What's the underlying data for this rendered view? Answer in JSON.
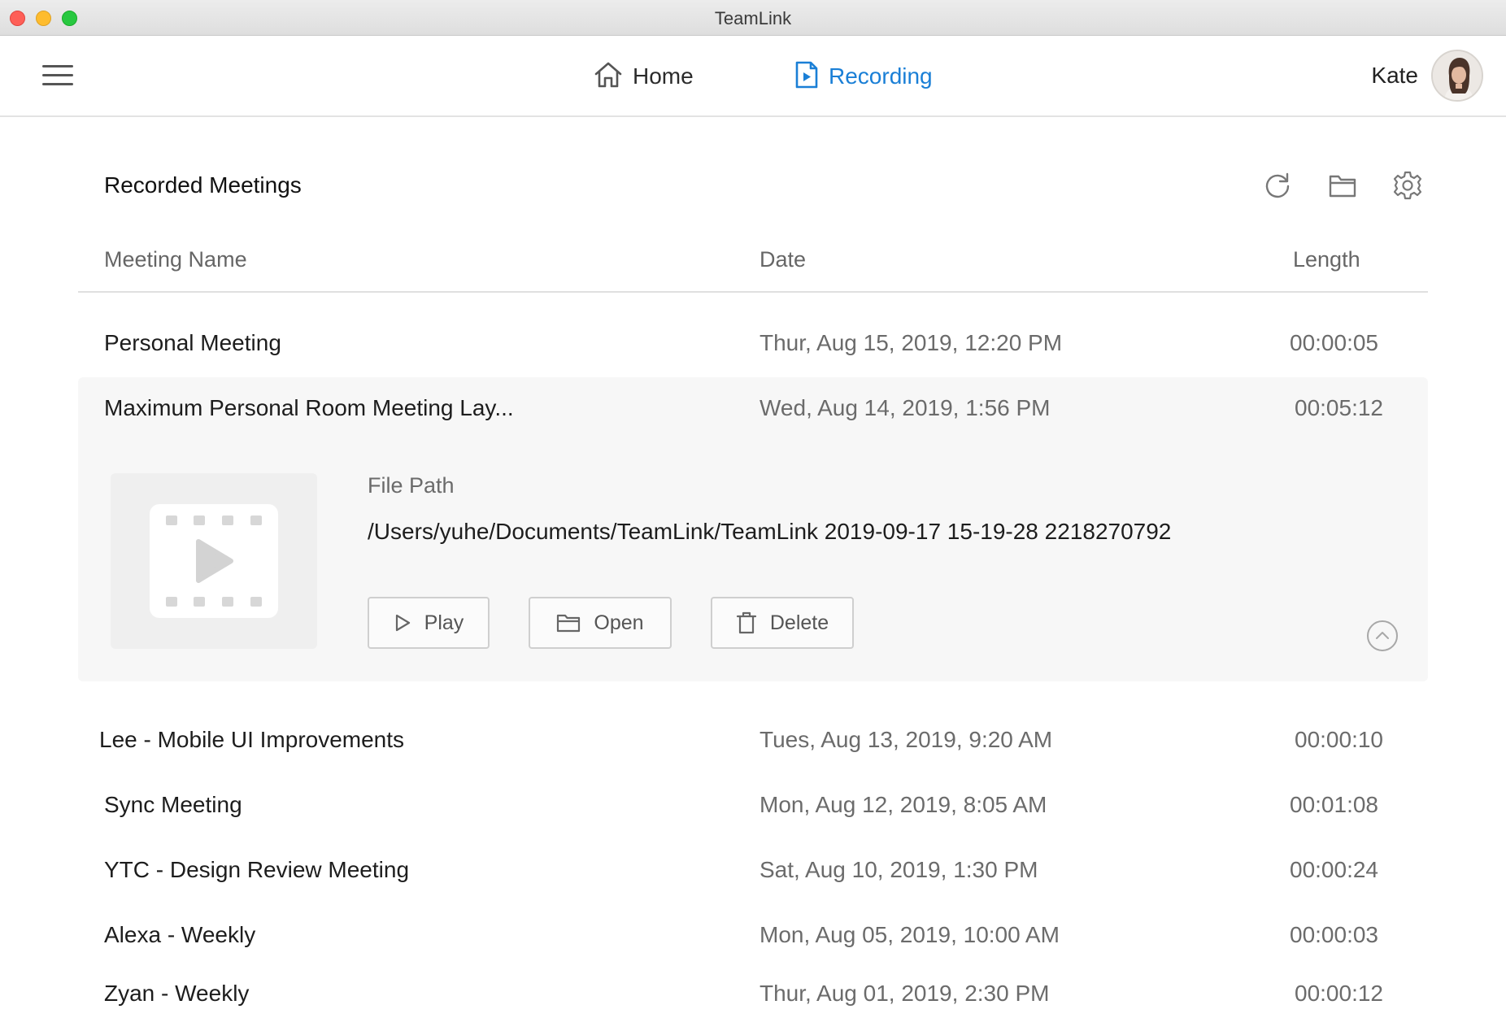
{
  "window": {
    "title": "TeamLink"
  },
  "nav": {
    "menu_icon": "hamburger-menu-icon",
    "items": [
      {
        "label": "Home",
        "icon": "house-icon",
        "active": false
      },
      {
        "label": "Recording",
        "icon": "recording-file-icon",
        "active": true
      }
    ],
    "accent_color": "#1a7fd6",
    "user": {
      "name": "Kate",
      "avatar": "user-avatar-photo"
    }
  },
  "page": {
    "section_title": "Recorded Meetings",
    "toolbar_icons": [
      "refresh-icon",
      "folder-icon",
      "gear-icon"
    ]
  },
  "table": {
    "columns": {
      "name": "Meeting Name",
      "date": "Date",
      "length": "Length"
    },
    "rows": [
      {
        "name": "Personal Meeting",
        "date": "Thur, Aug 15, 2019, 12:20 PM",
        "length": "00:00:05"
      },
      {
        "name": "Maximum Personal Room Meeting Lay...",
        "date": "Wed, Aug 14, 2019, 1:56 PM",
        "length": "00:05:12",
        "expanded": true
      },
      {
        "name": "Lee - Mobile UI Improvements",
        "date": "Tues, Aug 13, 2019, 9:20 AM",
        "length": "00:00:10"
      },
      {
        "name": "Sync Meeting",
        "date": "Mon, Aug 12, 2019, 8:05 AM",
        "length": "00:01:08"
      },
      {
        "name": "YTC - Design Review Meeting",
        "date": "Sat, Aug 10, 2019, 1:30 PM",
        "length": "00:00:24"
      },
      {
        "name": "Alexa - Weekly",
        "date": "Mon, Aug 05, 2019, 10:00 AM",
        "length": "00:00:03"
      },
      {
        "name": "Zyan - Weekly",
        "date": "Thur, Aug 01, 2019, 2:30 PM",
        "length": "00:00:12"
      }
    ]
  },
  "detail": {
    "file_path_label": "File Path",
    "file_path": "/Users/yuhe/Documents/TeamLink/TeamLink 2019-09-17 15-19-28 2218270792",
    "buttons": {
      "play": "Play",
      "open": "Open",
      "delete": "Delete"
    },
    "thumbnail_icon": "video-play-icon",
    "collapse_icon": "chevron-up-circle-icon"
  }
}
